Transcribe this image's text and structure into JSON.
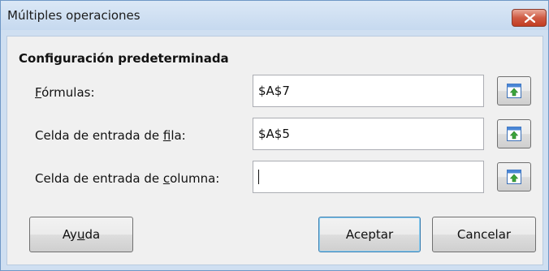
{
  "window": {
    "title": "Múltiples operaciones"
  },
  "section": {
    "title": "Configuración predeterminada"
  },
  "rows": [
    {
      "label_pre": "",
      "label_ul": "F",
      "label_post": "órmulas:",
      "value": "$A$7"
    },
    {
      "label_pre": "Celda de entrada de ",
      "label_ul": "f",
      "label_post": "ila:",
      "value": "$A$5"
    },
    {
      "label_pre": "Celda de entrada de ",
      "label_ul": "c",
      "label_post": "olumna:",
      "value": ""
    }
  ],
  "buttons": {
    "help_pre": "Ay",
    "help_ul": "u",
    "help_post": "da",
    "ok": "Aceptar",
    "cancel": "Cancelar"
  },
  "icons": {
    "close": "close-icon",
    "shrink": "shrink-range-icon"
  },
  "colors": {
    "title_bar": "#cfdff1",
    "close_button": "#c8472f",
    "dialog_body": "#f0f0f0"
  }
}
